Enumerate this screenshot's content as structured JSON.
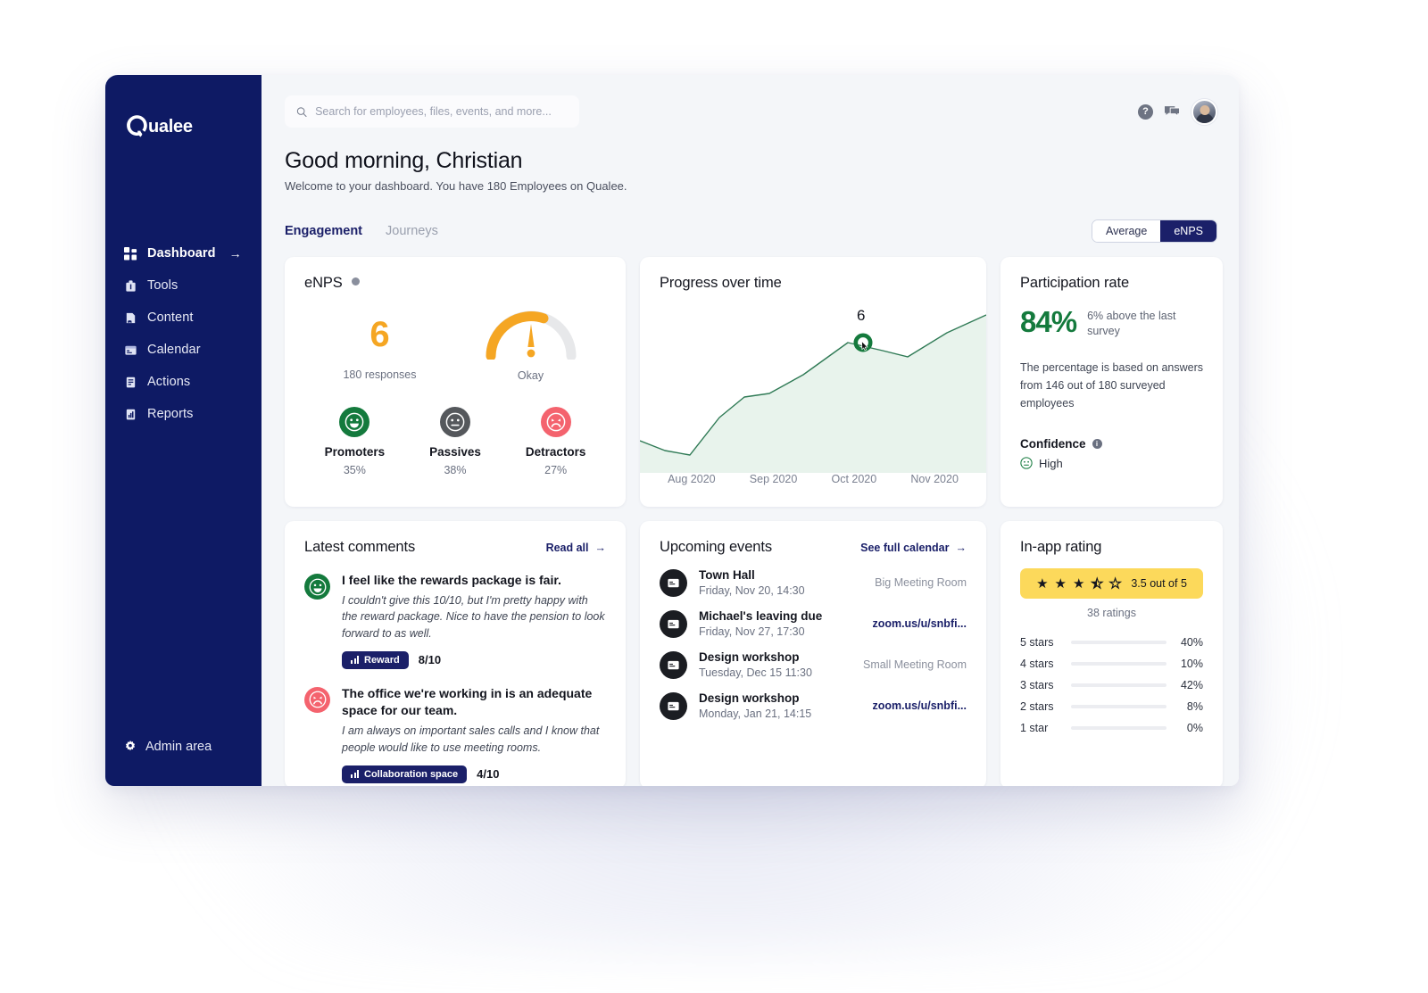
{
  "brand": {
    "name": "Qualee",
    "primary_color": "#0e1a64",
    "accent_color": "#1b2069"
  },
  "sidebar": {
    "items": [
      {
        "label": "Dashboard",
        "icon": "grid-icon",
        "active": true,
        "arrow": "→"
      },
      {
        "label": "Tools",
        "icon": "toolbox-icon",
        "active": false
      },
      {
        "label": "Content",
        "icon": "content-icon",
        "active": false
      },
      {
        "label": "Calendar",
        "icon": "calendar-icon",
        "active": false
      },
      {
        "label": "Actions",
        "icon": "actions-icon",
        "active": false
      },
      {
        "label": "Reports",
        "icon": "reports-icon",
        "active": false
      }
    ],
    "admin": {
      "label": "Admin area",
      "icon": "gear-icon"
    }
  },
  "topbar": {
    "search_placeholder": "Search for employees, files, events, and more...",
    "search_value": "",
    "help_icon": "question-mark-icon",
    "chat_icon": "chat-bubble-icon",
    "avatar": "user-avatar"
  },
  "greeting": {
    "title": "Good morning, Christian",
    "subtitle": "Welcome to your dashboard. You have 180 Employees on Qualee."
  },
  "tabs": [
    {
      "label": "Engagement",
      "active": true
    },
    {
      "label": "Journeys",
      "active": false
    }
  ],
  "segmented": [
    {
      "label": "Average",
      "active": false
    },
    {
      "label": "eNPS",
      "active": true
    }
  ],
  "enps": {
    "title": "eNPS",
    "score": "6",
    "responses": "180 responses",
    "gauge_label": "Okay",
    "gauge_color": "#f5a623",
    "gauge_fill_pct": 62,
    "segments": [
      {
        "name": "Promoters",
        "pct": "35%",
        "color": "#147a3d",
        "face": "happy-face-icon"
      },
      {
        "name": "Passives",
        "pct": "38%",
        "color": "#55585c",
        "face": "neutral-face-icon"
      },
      {
        "name": "Detractors",
        "pct": "27%",
        "color": "#f4636e",
        "face": "sad-face-icon"
      }
    ]
  },
  "progress": {
    "title": "Progress over time",
    "highlight_value": "6"
  },
  "chart_data": {
    "type": "area",
    "title": "Progress over time",
    "xlabel": "",
    "ylabel": "",
    "x": [
      "Aug 2020",
      "Sep 2020",
      "Oct 2020",
      "Nov 2020"
    ],
    "tick_labels": [
      "Aug 2020",
      "Sep 2020",
      "Oct 2020",
      "Nov 2020"
    ],
    "series": [
      {
        "name": "eNPS",
        "color": "#2f7a55",
        "fill": "#e8f3ec",
        "points": [
          {
            "x": 0,
            "y": 1.2
          },
          {
            "x": 0.5,
            "y": 0.6
          },
          {
            "x": 1.0,
            "y": 0.4
          },
          {
            "x": 1.6,
            "y": 2.3
          },
          {
            "x": 2.1,
            "y": 3.3
          },
          {
            "x": 2.6,
            "y": 3.5
          },
          {
            "x": 3.3,
            "y": 4.4
          },
          {
            "x": 4.2,
            "y": 6.0
          },
          {
            "x": 4.9,
            "y": 5.6
          },
          {
            "x": 5.4,
            "y": 5.3
          },
          {
            "x": 6.2,
            "y": 6.5
          },
          {
            "x": 7.0,
            "y": 7.4
          }
        ]
      }
    ],
    "annotation": {
      "label": "6",
      "x": 4.2,
      "y": 6.0
    },
    "grid": false,
    "legend": "none"
  },
  "participation": {
    "title": "Participation rate",
    "value": "84%",
    "note": "6% above the last survey",
    "description": "The percentage is based on answers from 146 out of 180 surveyed employees",
    "confidence_label": "Confidence",
    "confidence_value": "High",
    "confidence_icon": "neutral-face-icon"
  },
  "comments": {
    "title": "Latest comments",
    "read_all": "Read all",
    "items": [
      {
        "sentiment": "positive",
        "face": "happy-face-icon",
        "title": "I feel like the rewards package is fair.",
        "text": "I couldn't give this 10/10, but I'm pretty happy with the reward package. Nice to have the pension to look forward to as well.",
        "badge": "Reward",
        "score": "8/10"
      },
      {
        "sentiment": "negative",
        "face": "sad-face-icon",
        "title": "The office we're working in is an adequate space for our team.",
        "text": "I am always on important sales calls and I know that people would like to use meeting rooms.",
        "badge": "Collaboration space",
        "score": "4/10"
      }
    ]
  },
  "events": {
    "title": "Upcoming events",
    "see_calendar": "See full calendar",
    "items": [
      {
        "name": "Town Hall",
        "date": "Friday, Nov 20, 14:30",
        "location": "Big Meeting Room",
        "is_link": false
      },
      {
        "name": "Michael's leaving due",
        "date": "Friday, Nov 27, 17:30",
        "location": "zoom.us/u/snbfi...",
        "is_link": true
      },
      {
        "name": "Design workshop",
        "date": "Tuesday, Dec 15 11:30",
        "location": "Small Meeting Room",
        "is_link": false
      },
      {
        "name": "Design workshop",
        "date": "Monday, Jan 21, 14:15",
        "location": "zoom.us/u/snbfi...",
        "is_link": true
      }
    ]
  },
  "rating": {
    "title": "In-app rating",
    "stars_full": 3,
    "stars_half": 1,
    "stars_empty": 1,
    "summary": "3.5 out of 5",
    "count": "38 ratings",
    "accent_color": "#fcd95b",
    "breakdown": [
      {
        "label": "5 stars",
        "pct": "40%",
        "value": 40
      },
      {
        "label": "4 stars",
        "pct": "10%",
        "value": 10
      },
      {
        "label": "3 stars",
        "pct": "42%",
        "value": 42
      },
      {
        "label": "2 stars",
        "pct": "8%",
        "value": 8
      },
      {
        "label": "1 star",
        "pct": "0%",
        "value": 0
      }
    ]
  }
}
